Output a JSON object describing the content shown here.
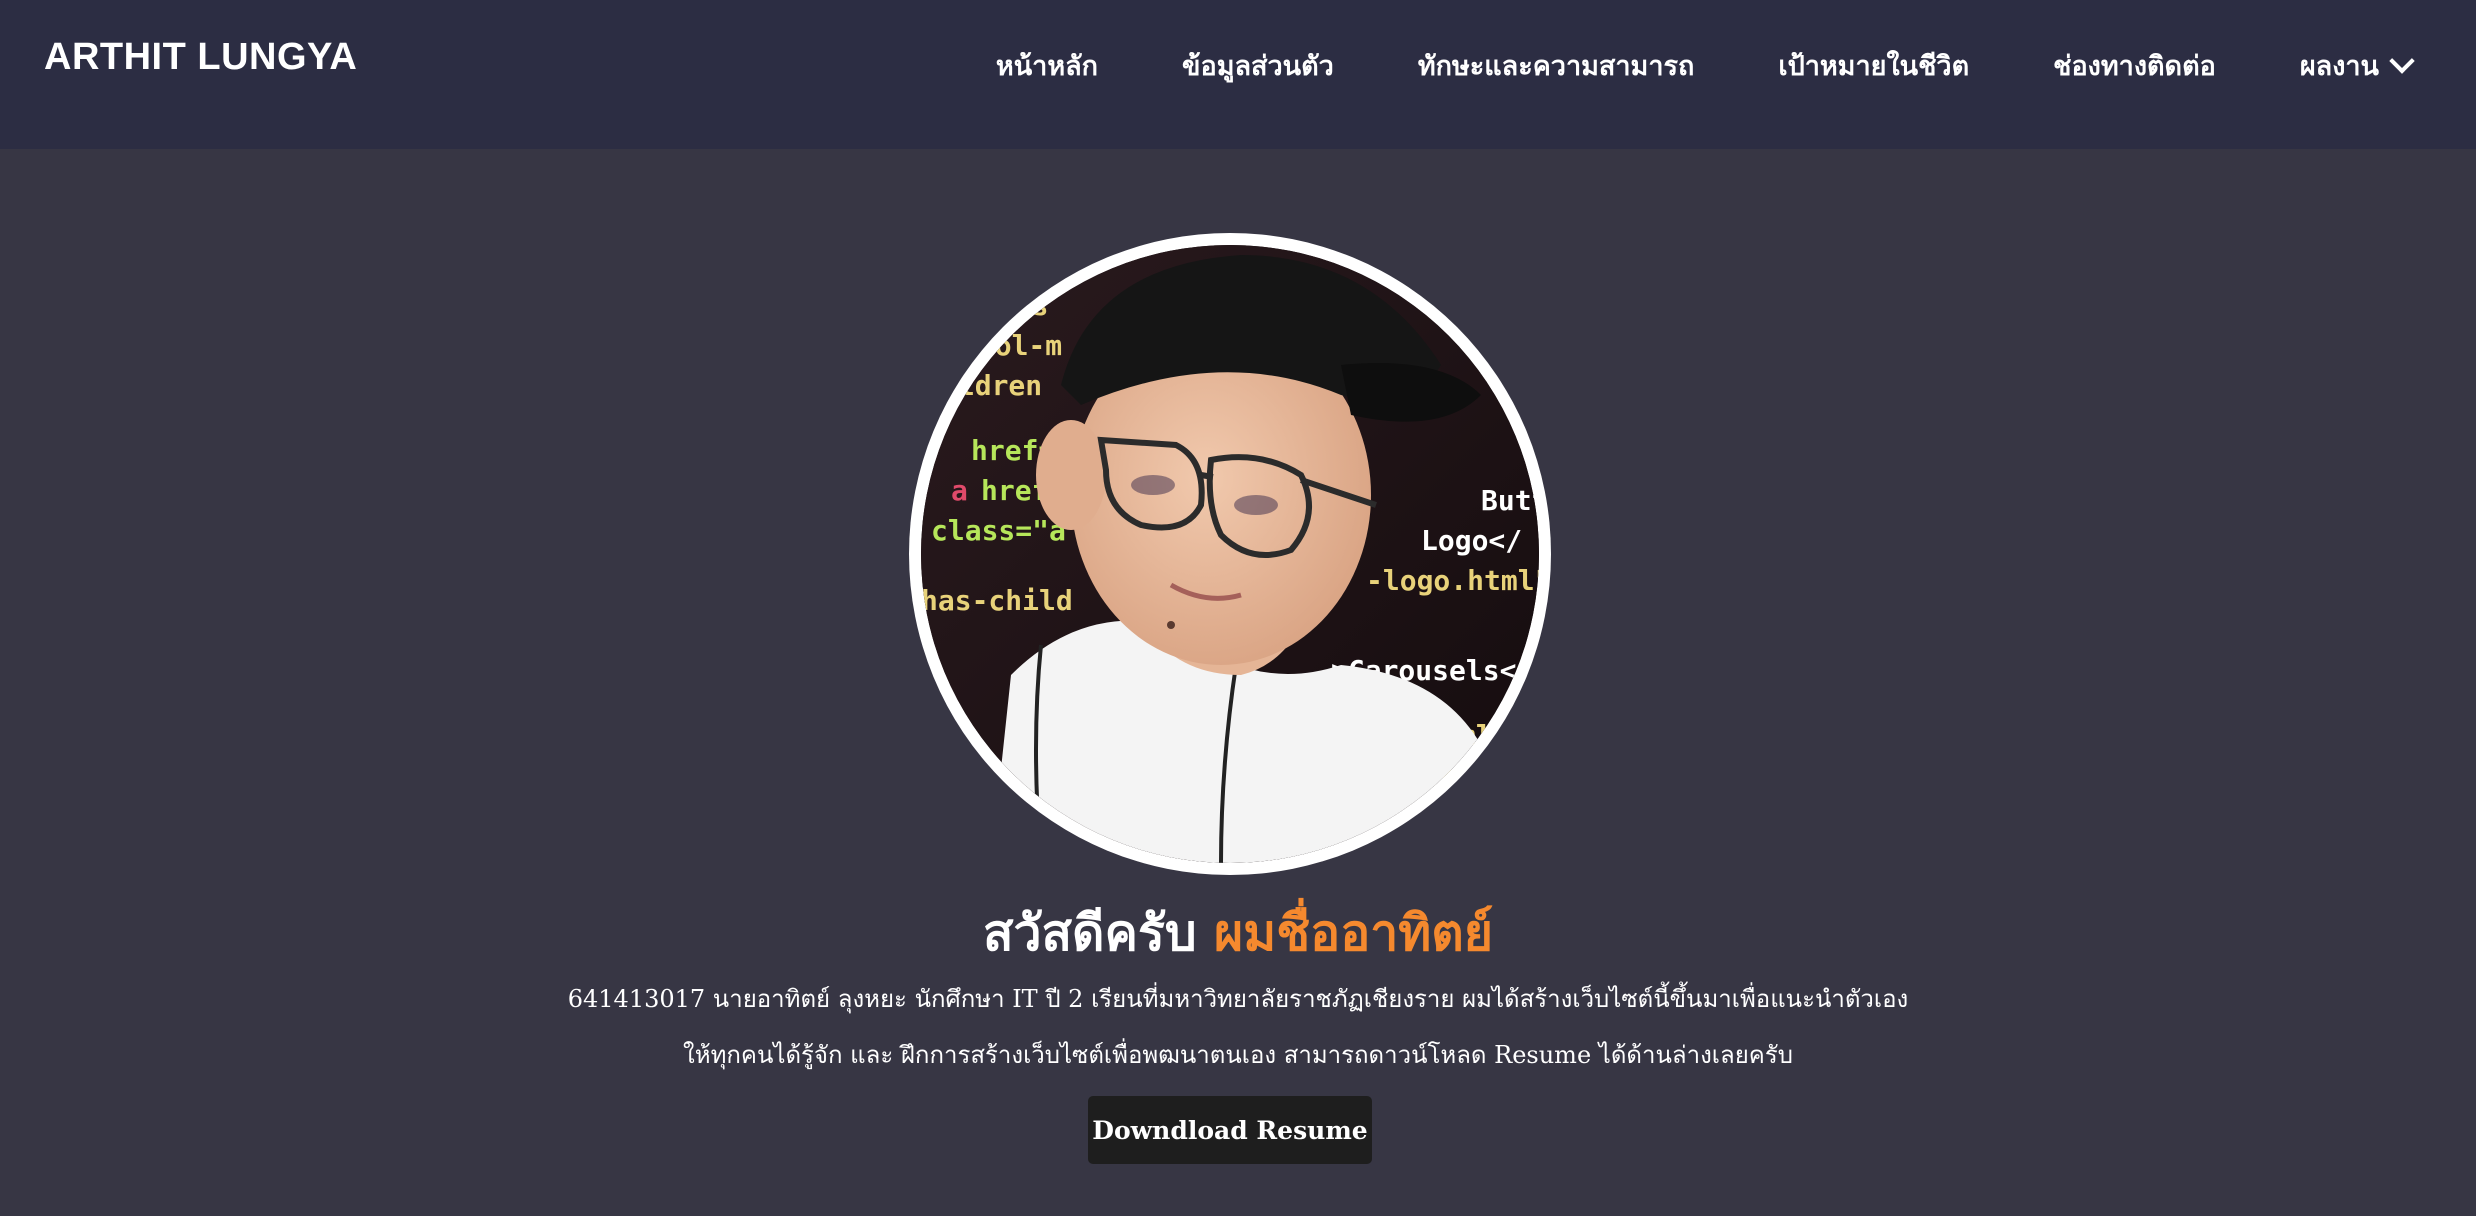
{
  "header": {
    "brand": "ARTHIT LUNGYA",
    "nav": [
      {
        "label": "หน้าหลัก"
      },
      {
        "label": "ข้อมูลส่วนตัว"
      },
      {
        "label": "ทักษะและความสามารถ"
      },
      {
        "label": "เป้าหมายในชีวิต"
      },
      {
        "label": "ช่องทางติดต่อ"
      },
      {
        "label": "ผลงาน",
        "icon": "chevron-down-icon"
      }
    ]
  },
  "hero": {
    "avatar_description": "profile-photo",
    "greeting_prefix": "สวัสดีครับ",
    "greeting_name": "ผมชื่ออาทิตย์",
    "intro_line1": "641413017 นายอาทิตย์ ลุงหยะ นักศึกษา IT ปี 2 เรียนที่มหาวิทยาลัยราชภัฏเชียงราย ผมได้สร้างเว็บไซต์นี้ขึ้นมาเพื่อแนะนำตัวเอง",
    "intro_line2": "ให้ทุกคนได้รู้จัก และ ฝึกการสร้างเว็บไซต์เพื่อพฒนาตนเอง สามารถดาวน์โหลด Resume ได้ด้านล่างเลยครับ",
    "download_button": "Downdload Resume"
  },
  "colors": {
    "navbar": "#2c2d43",
    "background": "#373644",
    "accent": "#f5892e",
    "button": "#1e1e1e"
  }
}
